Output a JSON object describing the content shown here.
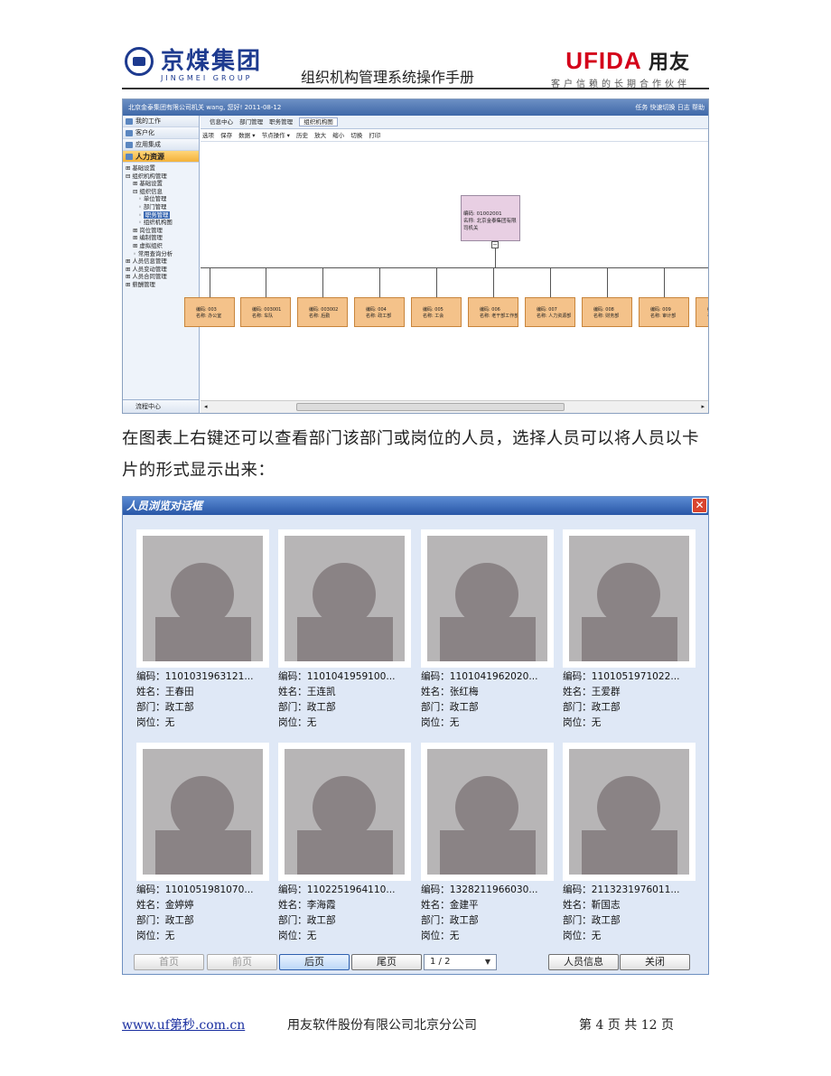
{
  "header": {
    "logo_cn": "京煤集团",
    "logo_en": "JINGMEI GROUP",
    "doc_title": "组织机构管理系统操作手册",
    "brand_main": "UFIDA",
    "brand_cn": "用友",
    "brand_slogan": "客户信赖的长期合作伙伴"
  },
  "screenshot1": {
    "titlebar": "北京金泰集团有限公司机关 wang, 您好! 2011-08-12",
    "titlebar_right": "任务  快速切换  日志  帮助",
    "nav": [
      "我的工作",
      "客户化",
      "应用集成",
      "人力资源"
    ],
    "tree": [
      "基础设置",
      "组织机构管理",
      "基础设置",
      "组织信息",
      "单位管理",
      "部门管理",
      "职务管理",
      "组织机构图",
      "岗位管理",
      "编制管理",
      "虚拟组织",
      "常用查询分析",
      "人员信息管理",
      "人员变动管理",
      "人员合同管理",
      "薪酬管理"
    ],
    "bottom_nav": "流程中心",
    "tabs": [
      "信息中心",
      "部门管理",
      "职务管理",
      "组织机构图"
    ],
    "toolbar": [
      "选项",
      "保存",
      "数据 ▾",
      "节点操作 ▾",
      "历史",
      "放大",
      "缩小",
      "切换",
      "打印"
    ],
    "root_node": [
      "编码: 01002001",
      "名称: 北京金泰集团有限",
      "司机关"
    ],
    "child_nodes": [
      {
        "code": "编码: 003",
        "name": "名称: 办公室"
      },
      {
        "code": "编码: 003001",
        "name": "名称: 车队"
      },
      {
        "code": "编码: 003002",
        "name": "名称: 后勤"
      },
      {
        "code": "编码: 004",
        "name": "名称: 政工部"
      },
      {
        "code": "编码: 005",
        "name": "名称: 工会"
      },
      {
        "code": "编码: 006",
        "name": "名称: 老干部工作部"
      },
      {
        "code": "编码: 007",
        "name": "名称: 人力资源部"
      },
      {
        "code": "编码: 008",
        "name": "名称: 财务部"
      },
      {
        "code": "编码: 009",
        "name": "名称: 审计部"
      },
      {
        "code": "编",
        "name": "名"
      }
    ]
  },
  "paragraph": "在图表上右键还可以查看部门该部门或岗位的人员，选择人员可以将人员以卡片的形式显示出来：",
  "dialog": {
    "title": "人员浏览对话框",
    "close": "✕",
    "cards": [
      {
        "code": "编码：1101031963121...",
        "name": "姓名：王春田",
        "dept": "部门：政工部",
        "post": "岗位：无"
      },
      {
        "code": "编码：1101041959100...",
        "name": "姓名：王连凯",
        "dept": "部门：政工部",
        "post": "岗位：无"
      },
      {
        "code": "编码：1101041962020...",
        "name": "姓名：张红梅",
        "dept": "部门：政工部",
        "post": "岗位：无"
      },
      {
        "code": "编码：1101051971022...",
        "name": "姓名：王爱群",
        "dept": "部门：政工部",
        "post": "岗位：无"
      },
      {
        "code": "编码：1101051981070...",
        "name": "姓名：金婷婷",
        "dept": "部门：政工部",
        "post": "岗位：无"
      },
      {
        "code": "编码：1102251964110...",
        "name": "姓名：李海霞",
        "dept": "部门：政工部",
        "post": "岗位：无"
      },
      {
        "code": "编码：1328211966030...",
        "name": "姓名：金建平",
        "dept": "部门：政工部",
        "post": "岗位：无"
      },
      {
        "code": "编码：2113231976011...",
        "name": "姓名：靳国志",
        "dept": "部门：政工部",
        "post": "岗位：无"
      }
    ],
    "buttons": {
      "first": "首页",
      "prev": "前页",
      "next": "后页",
      "last": "尾页",
      "page": "1 / 2",
      "info": "人员信息",
      "close": "关闭"
    }
  },
  "footer": {
    "link": "www.uf第秒.com.cn",
    "company": "用友软件股份有限公司北京分公司",
    "page": "第 4 页 共 12 页"
  }
}
